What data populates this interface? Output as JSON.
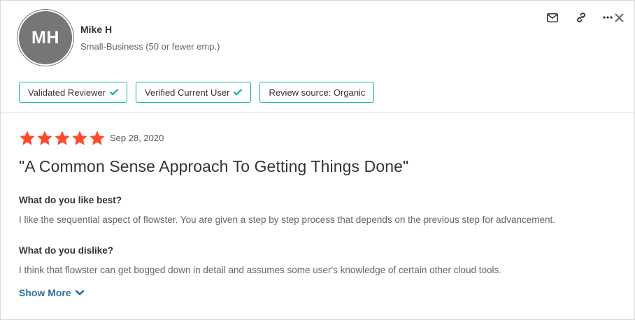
{
  "reviewer": {
    "initials": "MH",
    "name": "Mike H",
    "segment": "Small-Business (50 or fewer emp.)"
  },
  "actions": {
    "icons": [
      "mail-icon",
      "link-icon",
      "more-icon",
      "close-icon"
    ]
  },
  "badges": [
    {
      "label": "Validated Reviewer",
      "checked": true
    },
    {
      "label": "Verified Current User",
      "checked": true
    },
    {
      "label": "Review source: Organic",
      "checked": false
    }
  ],
  "review": {
    "rating": 5,
    "date": "Sep 28, 2020",
    "title": "\"A Common Sense Approach To Getting Things Done\"",
    "q1": "What do you like best?",
    "a1": "I like the sequential aspect of flowster. You are given a step by step process that depends on the previous step for advancement.",
    "q2": "What do you dislike?",
    "a2": "I think that flowster can get bogged down in detail and assumes some user's knowledge of certain other cloud tools.",
    "show_more": "Show More"
  },
  "colors": {
    "star": "#ff492c",
    "badge_border": "#0ab4a3",
    "link": "#2f6f9f",
    "avatar": "#767676"
  }
}
